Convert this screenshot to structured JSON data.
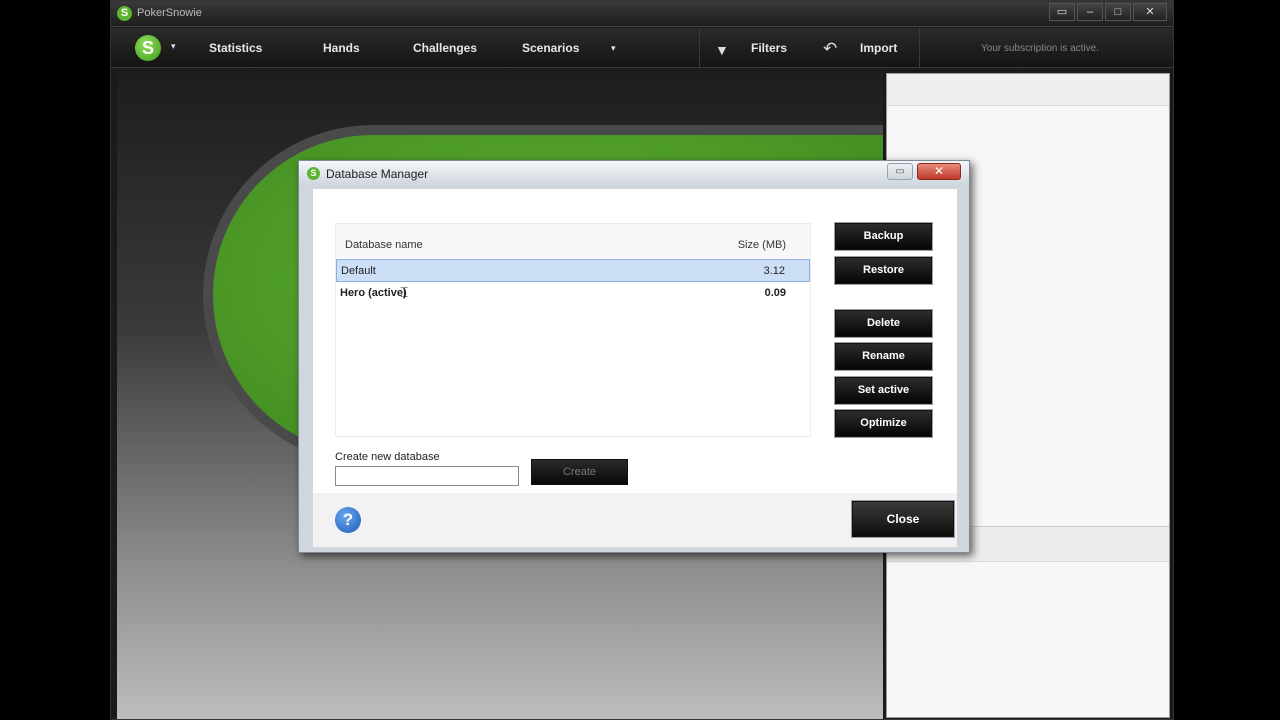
{
  "app": {
    "title": "PokerSnowie",
    "logo_letter": "S",
    "window_controls": {
      "restore": "▭",
      "minimize": "–",
      "maximize": "□",
      "close": "✕"
    }
  },
  "nav": {
    "caret": "▾",
    "items": [
      "Statistics",
      "Hands",
      "Challenges",
      "Scenarios"
    ],
    "scenarios_caret": "▾",
    "filters_label": "Filters",
    "import_label": "Import",
    "subscription_status": "Your subscription is active."
  },
  "dialog": {
    "title": "Database Manager",
    "logo_letter": "S",
    "close_glyph": "✕",
    "restore_glyph": "▭",
    "table": {
      "col_name": "Database name",
      "col_size": "Size (MB)",
      "rows": [
        {
          "name": "Default",
          "size": "3.12",
          "selected": true,
          "active": false
        },
        {
          "name": "Hero (active)",
          "size": "0.09",
          "selected": false,
          "active": true
        }
      ]
    },
    "buttons": {
      "backup": "Backup",
      "restore": "Restore",
      "delete": "Delete",
      "rename": "Rename",
      "set_active": "Set active",
      "optimize": "Optimize",
      "create": "Create",
      "close": "Close"
    },
    "create_label": "Create new database",
    "create_input_value": "",
    "help_glyph": "?"
  },
  "colors": {
    "brand_green": "#5cb531",
    "selection": "#cddff7",
    "button_black": "#0e0e0e"
  },
  "icons": {
    "filter": "filter-icon",
    "import": "undo-arrow-icon",
    "help": "question-icon",
    "cursor": "text-cursor-icon"
  }
}
